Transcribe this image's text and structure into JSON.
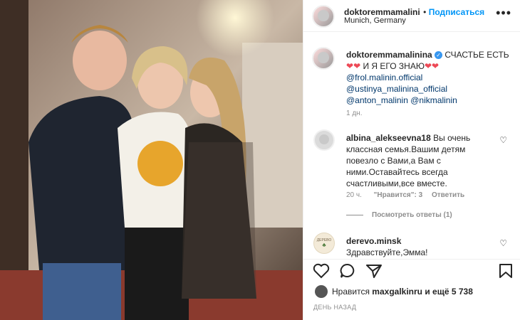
{
  "post": {
    "author": "doktoremmamalini",
    "follow_label": "Подписаться",
    "location": "Munich, Germany"
  },
  "caption": {
    "author": "doktoremmamalinina",
    "text_part1": "СЧАСТЬЕ ЕСТЬ",
    "text_part2": "И Я ЕГО ЗНАЮ",
    "mentions": [
      "@frol.malinin.official",
      "@ustinya_malinina_official",
      "@anton_malinin",
      "@nikmalinin"
    ],
    "time": "1 дн."
  },
  "comments": [
    {
      "author": "albina_alekseevna18",
      "text": "Вы очень классная семья.Вашим детям повезло с Вами,а Вам с ними.Оставайтесь всегда счастливыми,все вместе.",
      "time": "20 ч.",
      "likes": "\"Нравится\": 3",
      "reply": "Ответить",
      "view_replies": "Посмотреть ответы (1)"
    },
    {
      "author": "derevo.minsk",
      "text": "Здравствуйте,Эмма!",
      "avatar_text": "ДЕРЕВО"
    }
  ],
  "likes": {
    "prefix": "Нравится",
    "user": "maxgalkinru",
    "suffix": "и ещё 5 738"
  },
  "date": "ДЕНЬ НАЗАД",
  "colors": {
    "accent": "#0095f6",
    "heart": "#ed4956",
    "muted": "#8e8e8e",
    "verified": "#3897f0"
  }
}
